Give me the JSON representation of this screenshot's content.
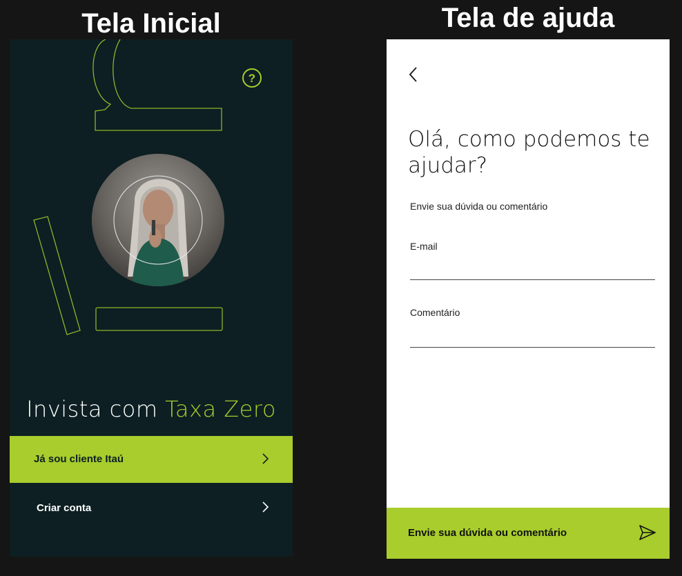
{
  "screens": {
    "left_title": "Tela Inicial",
    "right_title": "Tela de ajuda"
  },
  "home": {
    "help_icon_glyph": "?",
    "tagline_prefix": "Invista com",
    "tagline_accent": "Taxa Zero",
    "client_button_label": "Já sou cliente Itaú",
    "create_account_label": "Criar conta"
  },
  "help": {
    "heading": "Olá, como podemos te ajudar?",
    "subtitle": "Envie sua dúvida ou comentário",
    "email_label": "E-mail",
    "email_value": "",
    "comment_label": "Comentário",
    "comment_value": "",
    "send_button_label": "Envie sua dúvida ou comentário"
  },
  "colors": {
    "accent": "#a8cd2c",
    "dark_background": "#0d1f22",
    "page_background": "#151515"
  },
  "icons": [
    "help-icon",
    "chevron-right-icon",
    "back-arrow-icon",
    "send-icon"
  ]
}
